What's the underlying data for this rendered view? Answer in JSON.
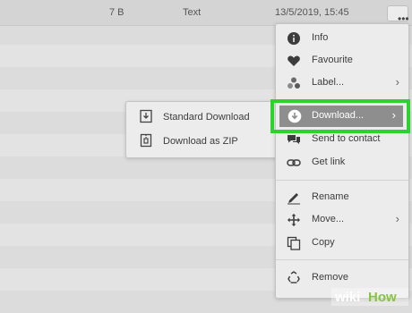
{
  "file_row": {
    "size": "7 B",
    "type": "Text",
    "date": "13/5/2019, 15:45",
    "more_label": "•••"
  },
  "context_menu": {
    "items": [
      {
        "label": "Info",
        "icon": "info-icon"
      },
      {
        "label": "Favourite",
        "icon": "heart-icon"
      },
      {
        "label": "Label...",
        "icon": "label-dots-icon"
      },
      {
        "label": "Download...",
        "icon": "download-circle-icon"
      },
      {
        "label": "Send to contact",
        "icon": "contact-bubble-icon"
      },
      {
        "label": "Get link",
        "icon": "link-icon"
      },
      {
        "label": "Rename",
        "icon": "pencil-icon"
      },
      {
        "label": "Move...",
        "icon": "move-arrows-icon"
      },
      {
        "label": "Copy",
        "icon": "copy-icon"
      },
      {
        "label": "Remove",
        "icon": "recycle-icon"
      }
    ],
    "chevron": "›"
  },
  "download_submenu": {
    "items": [
      {
        "label": "Standard Download",
        "icon": "download-box-icon"
      },
      {
        "label": "Download as ZIP",
        "icon": "zip-icon"
      }
    ]
  },
  "watermark": {
    "part1": "wiki",
    "part2": "How"
  },
  "colors": {
    "highlight": "#2ed22e",
    "selected_item_bg": "#8e8e8e",
    "menu_bg": "#ececec",
    "page_bg": "#e3e3e3"
  }
}
